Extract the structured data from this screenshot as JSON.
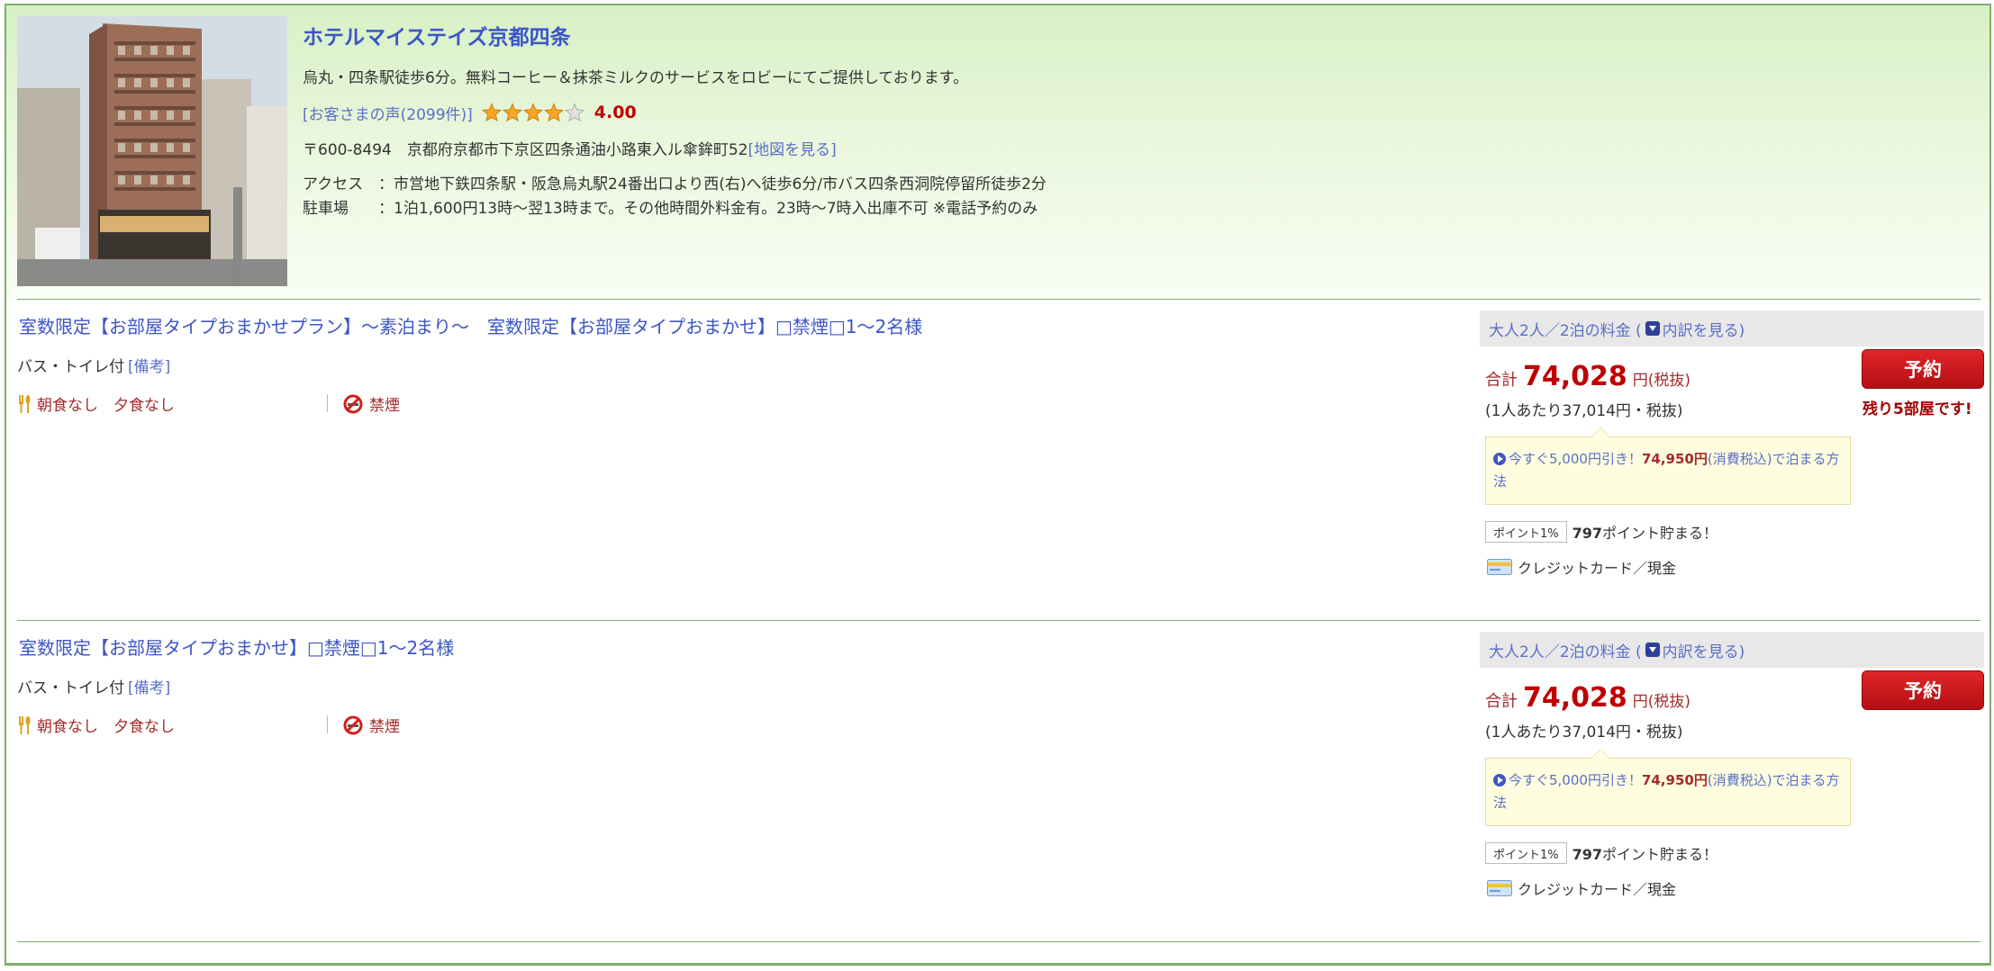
{
  "hotel": {
    "name": "ホテルマイステイズ京都四条",
    "catch_copy": "烏丸・四条駅徒歩6分。無料コーヒー＆抹茶ミルクのサービスをロビーにてご提供しております。",
    "review_link": "[お客さまの声(2099件)]",
    "rating": "4.00",
    "rating_value": 4.0,
    "rating_max": 5,
    "address": "〒600-8494　京都府京都市下京区四条通油小路東入ル傘鉾町52",
    "map_link": "[地図を見る]",
    "access_label": "アクセス",
    "access_text": "：市営地下鉄四条駅・阪急烏丸駅24番出口より西(右)へ徒歩6分/市バス四条西洞院停留所徒歩2分",
    "parking_label": "駐車場",
    "parking_text": "：1泊1,600円13時～翌13時まで。その他時間外料金有。23時～7時入出庫不可 ※電話予約のみ"
  },
  "plans": [
    {
      "title": "室数限定【お部屋タイプおまかせプラン】～素泊まり～　室数限定【お部屋タイプおまかせ】□禁煙□1～2名様",
      "bath": "バス・トイレ付",
      "biko": "[備考]",
      "meal": "朝食なし　夕食なし",
      "smoking": "禁煙",
      "price_header": "大人2人／2泊の料金 (",
      "breakdown_link": "内訳を見る)",
      "total_label": "合計",
      "total_amount": "74,028",
      "total_unit": "円(税抜)",
      "per_person": "(1人あたり37,014円・税抜)",
      "tip_text": "今すぐ5,000円引き！",
      "tip_price": "74,950円",
      "tip_rest": "(消費税込)で泊まる方法",
      "point_badge": "ポイント1%",
      "point_amount": "797",
      "point_text": "ポイント貯まる！",
      "payment": "クレジットカード／現金",
      "reserve": "予約",
      "remaining": "残り5部屋です!"
    },
    {
      "title": "室数限定【お部屋タイプおまかせ】□禁煙□1～2名様",
      "bath": "バス・トイレ付",
      "biko": "[備考]",
      "meal": "朝食なし　夕食なし",
      "smoking": "禁煙",
      "price_header": "大人2人／2泊の料金 (",
      "breakdown_link": "内訳を見る)",
      "total_label": "合計",
      "total_amount": "74,028",
      "total_unit": "円(税抜)",
      "per_person": "(1人あたり37,014円・税抜)",
      "tip_text": "今すぐ5,000円引き！",
      "tip_price": "74,950円",
      "tip_rest": "(消費税込)で泊まる方法",
      "point_badge": "ポイント1%",
      "point_amount": "797",
      "point_text": "ポイント貯まる！",
      "payment": "クレジットカード／現金",
      "reserve": "予約",
      "remaining": ""
    }
  ],
  "colors": {
    "link_blue": "#3c55c8",
    "price_red": "#c00000",
    "border_green": "#7bb069",
    "button_red": "#cc1a1e"
  }
}
